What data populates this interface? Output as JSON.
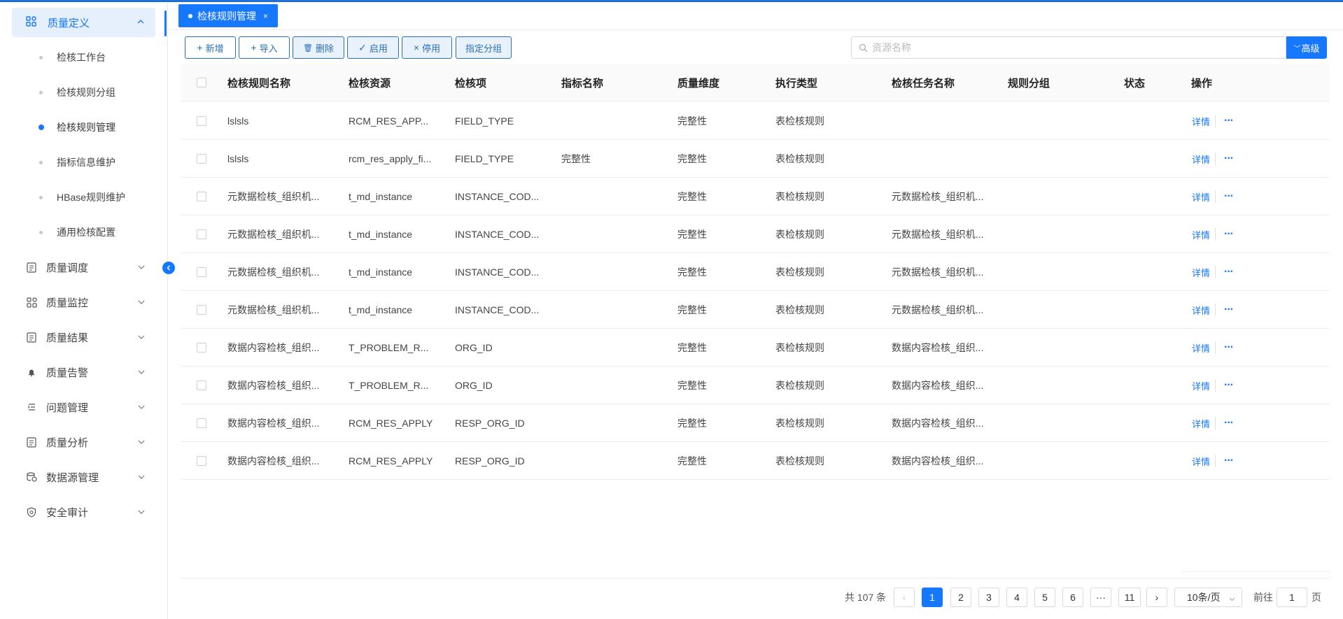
{
  "colors": {
    "primary": "#1677ff",
    "menu_active_bg": "#e6f0fd",
    "border_btn": "#2a6fb8"
  },
  "sidebar": {
    "group_open": {
      "label": "质量定义",
      "icon": "grid-icon"
    },
    "sub_items": [
      {
        "label": "检核工作台",
        "active": false
      },
      {
        "label": "检核规则分组",
        "active": false
      },
      {
        "label": "检核规则管理",
        "active": true
      },
      {
        "label": "指标信息维护",
        "active": false
      },
      {
        "label": "HBase规则维护",
        "active": false
      },
      {
        "label": "通用检核配置",
        "active": false
      }
    ],
    "groups": [
      {
        "label": "质量调度",
        "icon": "document-icon"
      },
      {
        "label": "质量监控",
        "icon": "grid-icon"
      },
      {
        "label": "质量结果",
        "icon": "document-icon"
      },
      {
        "label": "质量告警",
        "icon": "bell-icon"
      },
      {
        "label": "问题管理",
        "icon": "list-indent-icon"
      },
      {
        "label": "质量分析",
        "icon": "document-icon"
      },
      {
        "label": "数据源管理",
        "icon": "database-icon"
      },
      {
        "label": "安全审计",
        "icon": "shield-icon"
      }
    ]
  },
  "tabs": [
    {
      "label": "检核规则管理",
      "close": "×"
    }
  ],
  "toolbar": {
    "add": {
      "icon": "+",
      "label": "新增"
    },
    "import": {
      "icon": "+",
      "label": "导入"
    },
    "delete": {
      "icon": "🗑",
      "label": "删除"
    },
    "enable": {
      "icon": "✓",
      "label": "启用"
    },
    "disable": {
      "icon": "×",
      "label": "停用"
    },
    "assign_group": {
      "label": "指定分组"
    },
    "search_placeholder": "资源名称",
    "advanced": {
      "icon": "﹀",
      "label": "高级"
    }
  },
  "table": {
    "columns": [
      "检核规则名称",
      "检核资源",
      "检核项",
      "指标名称",
      "质量维度",
      "执行类型",
      "检核任务名称",
      "规则分组",
      "状态",
      "操作"
    ],
    "rows": [
      {
        "name": "lslsls",
        "resource": "RCM_RES_APP...",
        "item": "FIELD_TYPE",
        "metric": "",
        "dimension": "完整性",
        "exec_type": "表检核规则",
        "task": "",
        "group": "",
        "status": ""
      },
      {
        "name": "lslsls",
        "resource": "rcm_res_apply_fi...",
        "item": "FIELD_TYPE",
        "metric": "完整性",
        "dimension": "完整性",
        "exec_type": "表检核规则",
        "task": "",
        "group": "",
        "status": ""
      },
      {
        "name": "元数据检核_组织机...",
        "resource": "t_md_instance",
        "item": "INSTANCE_COD...",
        "metric": "",
        "dimension": "完整性",
        "exec_type": "表检核规则",
        "task": "元数据检核_组织机...",
        "group": "",
        "status": ""
      },
      {
        "name": "元数据检核_组织机...",
        "resource": "t_md_instance",
        "item": "INSTANCE_COD...",
        "metric": "",
        "dimension": "完整性",
        "exec_type": "表检核规则",
        "task": "元数据检核_组织机...",
        "group": "",
        "status": ""
      },
      {
        "name": "元数据检核_组织机...",
        "resource": "t_md_instance",
        "item": "INSTANCE_COD...",
        "metric": "",
        "dimension": "完整性",
        "exec_type": "表检核规则",
        "task": "元数据检核_组织机...",
        "group": "",
        "status": ""
      },
      {
        "name": "元数据检核_组织机...",
        "resource": "t_md_instance",
        "item": "INSTANCE_COD...",
        "metric": "",
        "dimension": "完整性",
        "exec_type": "表检核规则",
        "task": "元数据检核_组织机...",
        "group": "",
        "status": ""
      },
      {
        "name": "数据内容检核_组织...",
        "resource": "T_PROBLEM_R...",
        "item": "ORG_ID",
        "metric": "",
        "dimension": "完整性",
        "exec_type": "表检核规则",
        "task": "数据内容检核_组织...",
        "group": "",
        "status": ""
      },
      {
        "name": "数据内容检核_组织...",
        "resource": "T_PROBLEM_R...",
        "item": "ORG_ID",
        "metric": "",
        "dimension": "完整性",
        "exec_type": "表检核规则",
        "task": "数据内容检核_组织...",
        "group": "",
        "status": ""
      },
      {
        "name": "数据内容检核_组织...",
        "resource": "RCM_RES_APPLY",
        "item": "RESP_ORG_ID",
        "metric": "",
        "dimension": "完整性",
        "exec_type": "表检核规则",
        "task": "数据内容检核_组织...",
        "group": "",
        "status": ""
      },
      {
        "name": "数据内容检核_组织...",
        "resource": "RCM_RES_APPLY",
        "item": "RESP_ORG_ID",
        "metric": "",
        "dimension": "完整性",
        "exec_type": "表检核规则",
        "task": "数据内容检核_组织...",
        "group": "",
        "status": ""
      }
    ],
    "action_detail": "详情",
    "action_more": "···"
  },
  "pagination": {
    "total_text": "共 107 条",
    "prev": "‹",
    "next": "›",
    "pages": [
      "1",
      "2",
      "3",
      "4",
      "5",
      "6",
      "···",
      "11"
    ],
    "current": "1",
    "page_size": "10条/页",
    "goto_label": "前往",
    "goto_value": "1",
    "goto_suffix": "页"
  }
}
